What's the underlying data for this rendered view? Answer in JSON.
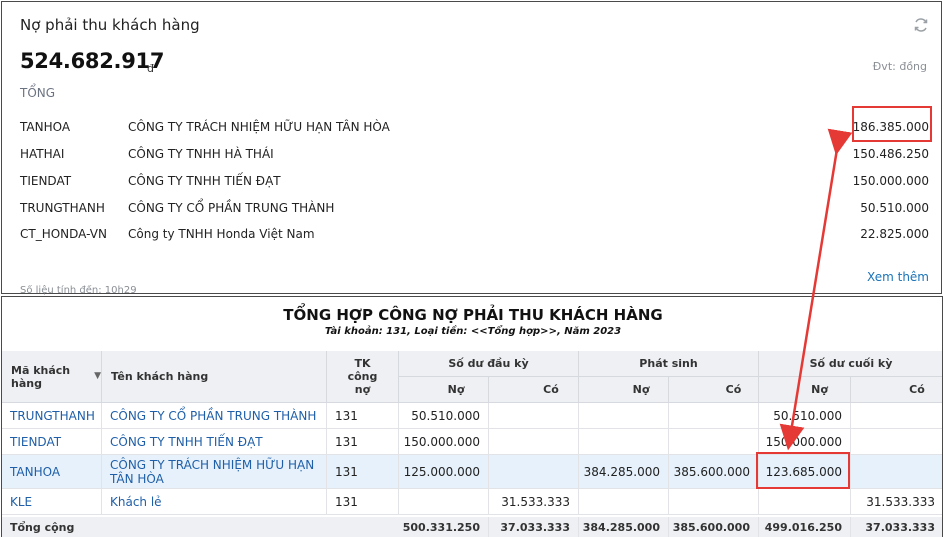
{
  "widget": {
    "title": "Nợ phải thu khách hàng",
    "refresh_icon": "refresh-icon",
    "amount": "524.682.917",
    "amount_unit": "đ",
    "unit_note": "Đvt: đồng",
    "total_label": "TỔNG",
    "rows": [
      {
        "code": "TANHOA",
        "name": "CÔNG TY TRÁCH NHIỆM HỮU HẠN TÂN HÒA",
        "value": "186.385.000"
      },
      {
        "code": "HATHAI",
        "name": "CÔNG TY TNHH HÀ THÁI",
        "value": "150.486.250"
      },
      {
        "code": "TIENDAT",
        "name": "CÔNG TY TNHH TIẾN ĐẠT",
        "value": "150.000.000"
      },
      {
        "code": "TRUNGTHANH",
        "name": "CÔNG TY CỔ PHẦN TRUNG THÀNH",
        "value": "50.510.000"
      },
      {
        "code": "CT_HONDA-VN",
        "name": "Công ty TNHH Honda Việt Nam",
        "value": "22.825.000"
      }
    ],
    "more_link": "Xem thêm",
    "footnote": "Số liệu tính đến: 10h29"
  },
  "report": {
    "title": "TỔNG HỢP CÔNG NỢ PHẢI THU KHÁCH HÀNG",
    "subtitle": "Tài khoản: 131, Loại tiền: <<Tổng hợp>>, Năm 2023",
    "headers": {
      "customer_code": "Mã khách hàng",
      "customer_name": "Tên khách hàng",
      "account": "TK công nợ",
      "opening": "Số dư đầu kỳ",
      "movement": "Phát sinh",
      "closing": "Số dư cuối kỳ",
      "debit": "Nợ",
      "credit": "Có"
    },
    "rows": [
      {
        "code": "TRUNGTHANH",
        "name": "CÔNG TY CỔ PHẦN TRUNG THÀNH",
        "account": "131",
        "open_debit": "50.510.000",
        "open_credit": "",
        "mv_debit": "",
        "mv_credit": "",
        "close_debit": "50.510.000",
        "close_credit": ""
      },
      {
        "code": "TIENDAT",
        "name": "CÔNG TY TNHH TIẾN ĐẠT",
        "account": "131",
        "open_debit": "150.000.000",
        "open_credit": "",
        "mv_debit": "",
        "mv_credit": "",
        "close_debit": "150.000.000",
        "close_credit": ""
      },
      {
        "code": "TANHOA",
        "name": "CÔNG TY TRÁCH NHIỆM HỮU HẠN TÂN HÒA",
        "account": "131",
        "open_debit": "125.000.000",
        "open_credit": "",
        "mv_debit": "384.285.000",
        "mv_credit": "385.600.000",
        "close_debit": "123.685.000",
        "close_credit": ""
      },
      {
        "code": "KLE",
        "name": "Khách lẻ",
        "account": "131",
        "open_debit": "",
        "open_credit": "31.533.333",
        "mv_debit": "",
        "mv_credit": "",
        "close_debit": "",
        "close_credit": "31.533.333"
      }
    ],
    "footer": {
      "label": "Tổng cộng",
      "open_debit": "500.331.250",
      "open_credit": "37.033.333",
      "mv_debit": "384.285.000",
      "mv_credit": "385.600.000",
      "close_debit": "499.016.250",
      "close_credit": "37.033.333"
    }
  },
  "annotation_color": "#e53935"
}
